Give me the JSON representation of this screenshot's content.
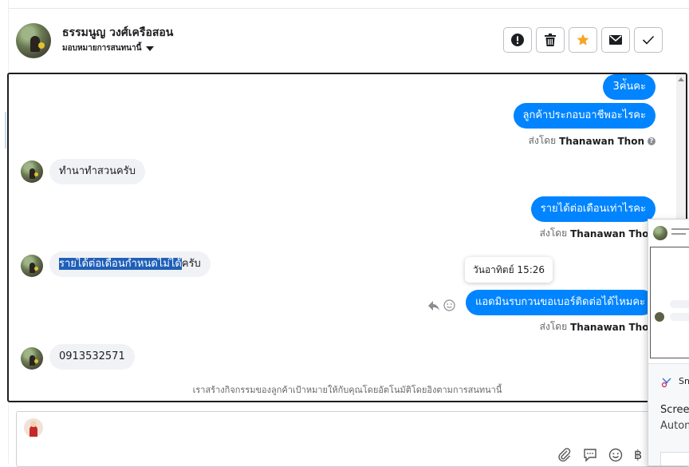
{
  "header": {
    "contact_name": "ธรรมนูญ วงศ์เครือสอน",
    "assign_label": "มอบหมายการสนทนานี้",
    "actions": [
      {
        "icon": "alert-icon",
        "color": "#1c1e21"
      },
      {
        "icon": "trash-icon",
        "color": "#1c1e21"
      },
      {
        "icon": "star-icon",
        "color": "#f5a623"
      },
      {
        "icon": "mail-icon",
        "color": "#1c1e21"
      },
      {
        "icon": "check-icon",
        "color": "#1c1e21"
      }
    ]
  },
  "conversation": {
    "messages": [
      {
        "direction": "out",
        "text": "3ค่ันคะ"
      },
      {
        "direction": "out",
        "text": "ลูกค้าประกอบอาชีพอะไรคะ"
      },
      {
        "direction": "in",
        "text": "ทำนาทำสวนครับ"
      },
      {
        "direction": "out",
        "text": "รายได้ต่อเดือนเท่าไรคะ"
      },
      {
        "direction": "in",
        "text_highlighted": "รายได้ต่อเดือนกำหนดไม่ได้",
        "text_rest": "ครับ"
      },
      {
        "direction": "out",
        "text": "แอดมินรบกวนขอเบอร์ติดต่อได้ไหมคะ"
      },
      {
        "direction": "in",
        "text": "0913532571"
      }
    ],
    "sent_by_prefix": "ส่งโดย",
    "sent_by_name": "Thanawan Thon",
    "tooltip_time": "วันอาทิตย์ 15:26",
    "footer_note": "เราสร้างกิจกรรมของลูกค้าเป้าหมายให้กับคุณโดยอัตโนมัติโดยอิงตามการสนทนานี้"
  },
  "composer": {
    "tools": [
      "paperclip-icon",
      "chat-bubble-icon",
      "smiley-icon",
      "baht-icon"
    ],
    "baht_symbol": "฿"
  },
  "popup": {
    "app_label": "Sn",
    "title": "Screen",
    "subtitle": "Autom"
  }
}
